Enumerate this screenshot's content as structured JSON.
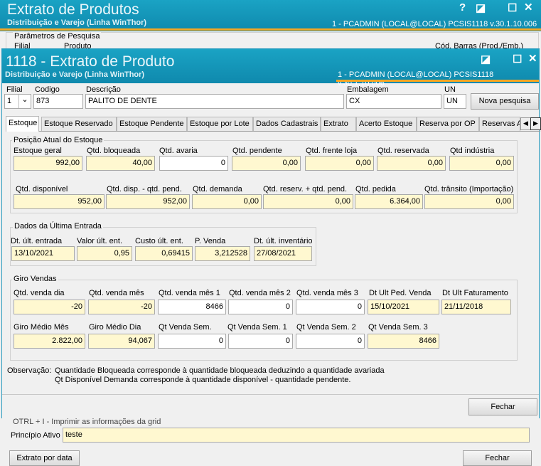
{
  "bg_window": {
    "title": "Extrato de Produtos",
    "subtitle": "Distribuição e Varejo (Linha WinThor)",
    "status": "1 - PCADMIN (LOCAL@LOCAL)   PCSIS1118  v.30.1.10.006",
    "params_label": "Parâmetros de Pesquisa",
    "filial_label": "Filial",
    "produto_label": "Produto",
    "codbarras_label": "Cód. Barras (Prod./Emb.)",
    "ctrl_help": "?",
    "ctrl_restore": "◪",
    "ctrl_max": "☐",
    "ctrl_close": "✕",
    "truncated_text": "OTRL + I - Imprimir as informações da grid",
    "principio_label": "Princípio Ativo",
    "principio_value": "teste",
    "extrato_btn": "Extrato por data",
    "fechar_btn": "Fechar"
  },
  "window": {
    "title": "1118 - Extrato de Produto",
    "subtitle": "Distribuição e Varejo (Linha WinThor)",
    "status": "1 - PCADMIN (LOCAL@LOCAL)   PCSIS1118  v.30.1.10.006",
    "ctrl_restore": "◪",
    "ctrl_max": "☐",
    "ctrl_close": "✕"
  },
  "header": {
    "filial_label": "Filial",
    "filial_value": "1",
    "codigo_label": "Codigo",
    "codigo_value": "873",
    "descricao_label": "Descrição",
    "descricao_value": "PALITO DE DENTE",
    "embalagem_label": "Embalagem",
    "embalagem_value": "CX",
    "un_label": "UN",
    "un_value": "UN",
    "nova_pesquisa": "Nova pesquisa"
  },
  "tabs": [
    "Estoque",
    "Estoque Reservado",
    "Estoque Pendente",
    "Estoque por Lote",
    "Dados Cadastrais",
    "Extrato",
    "Acerto Estoque",
    "Reserva por OP",
    "Reservas A"
  ],
  "posicao": {
    "title": "Posição Atual do Estoque",
    "row1": [
      {
        "label": "Estoque geral",
        "value": "992,00"
      },
      {
        "label": "Qtd. bloqueada",
        "value": "40,00"
      },
      {
        "label": "Qtd. avaria",
        "value": "0"
      },
      {
        "label": "Qtd. pendente",
        "value": "0,00"
      },
      {
        "label": "Qtd. frente loja",
        "value": "0,00"
      },
      {
        "label": "Qtd. reservada",
        "value": "0,00"
      },
      {
        "label": "Qtd indústria",
        "value": "0,00"
      }
    ],
    "row2": [
      {
        "label": "Qtd. disponível",
        "value": "952,00"
      },
      {
        "label": "Qtd. disp. - qtd. pend.",
        "value": "952,00"
      },
      {
        "label": "Qtd. demanda",
        "value": "0,00"
      },
      {
        "label": "Qtd. reserv. + qtd. pend.",
        "value": "0,00"
      },
      {
        "label": "Qtd. pedida",
        "value": "6.364,00"
      },
      {
        "label": "Qtd. trânsito (Importação)",
        "value": "0,00"
      }
    ]
  },
  "ultima": {
    "title": "Dados da Última Entrada",
    "fields": [
      {
        "label": "Dt. últ. entrada",
        "value": "13/10/2021"
      },
      {
        "label": "Valor últ. ent.",
        "value": "0,95"
      },
      {
        "label": "Custo últ. ent.",
        "value": "0,69415"
      },
      {
        "label": "P. Venda",
        "value": "3,212528"
      },
      {
        "label": "Dt. últ. inventário",
        "value": "27/08/2021"
      }
    ]
  },
  "giro": {
    "title": "Giro Vendas",
    "row1": [
      {
        "label": "Qtd. venda dia",
        "value": "-20"
      },
      {
        "label": "Qtd. venda mês",
        "value": "-20"
      },
      {
        "label": "Qtd. venda mês 1",
        "value": "8466"
      },
      {
        "label": "Qtd. venda mês 2",
        "value": "0"
      },
      {
        "label": "Qtd. venda mês 3",
        "value": "0"
      },
      {
        "label": "Dt Ult Ped. Venda",
        "value": "15/10/2021"
      },
      {
        "label": "Dt Ult Faturamento",
        "value": "21/11/2018"
      }
    ],
    "row2": [
      {
        "label": "Giro Médio Mês",
        "value": "2.822,00"
      },
      {
        "label": "Giro Médio Dia",
        "value": "94,067"
      },
      {
        "label": "Qt Venda Sem.",
        "value": "0"
      },
      {
        "label": "Qt Venda Sem. 1",
        "value": "0"
      },
      {
        "label": "Qt Venda Sem. 2",
        "value": "0"
      },
      {
        "label": "Qt Venda Sem. 3",
        "value": "8466"
      }
    ]
  },
  "observacao": {
    "label": "Observação:",
    "line1": "Quantidade Bloqueada corresponde à quantidade bloqueada deduzindo a quantidade avariada",
    "line2": "Qt Disponível Demanda corresponde à quantidade disponível - quantidade pendente."
  },
  "fechar": "Fechar",
  "colors": {
    "title_bar": "#1aa3c4",
    "accent_line": "#f5a623",
    "field_bg": "#fff8d0"
  }
}
